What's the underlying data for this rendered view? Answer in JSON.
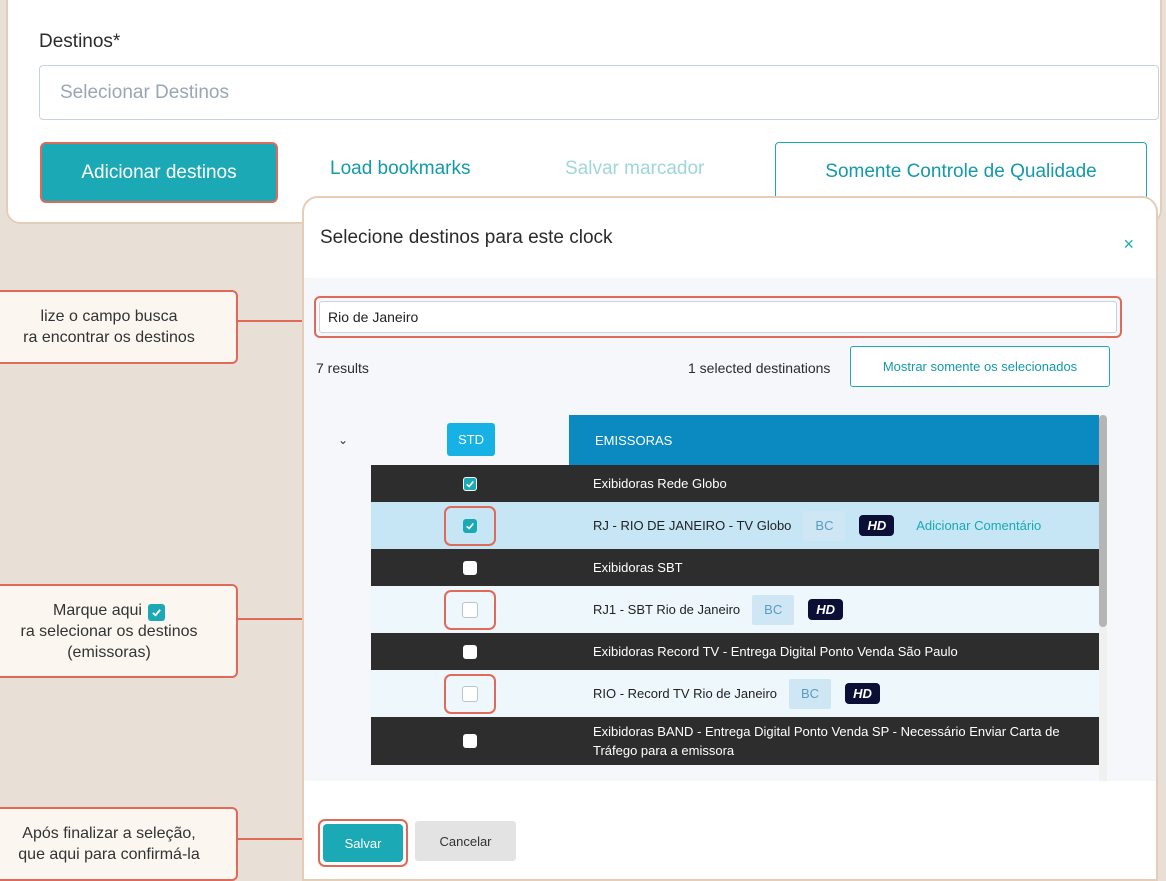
{
  "form": {
    "destinations_label": "Destinos*",
    "destinations_placeholder": "Selecionar Destinos",
    "add_button": "Adicionar destinos",
    "load_bookmarks": "Load bookmarks",
    "save_bookmark": "Salvar marcador",
    "quality_only": "Somente Controle de Qualidade"
  },
  "modal": {
    "title": "Selecione destinos para este clock",
    "close": "×",
    "search_value": "Rio de Janeiro",
    "results": "7 results",
    "selected_count": "1 selected destinations",
    "show_selected_button": "Mostrar somente os selecionados",
    "std_label": "STD",
    "column_header": "EMISSORAS",
    "groups": [
      {
        "label": "Exibidoras Rede Globo",
        "checked": true
      },
      {
        "label": "Exibidoras SBT",
        "checked": false
      },
      {
        "label": "Exibidoras Record TV - Entrega Digital Ponto Venda São Paulo",
        "checked": false
      },
      {
        "label": "Exibidoras BAND - Entrega Digital Ponto Venda SP - Necessário Enviar Carta de Tráfego para a emissora",
        "checked": false
      }
    ],
    "items": [
      {
        "label": "RJ - RIO DE JANEIRO - TV Globo",
        "bc": "BC",
        "hd": "HD",
        "comment": "Adicionar Comentário",
        "checked": true
      },
      {
        "label": "RJ1 - SBT Rio de Janeiro",
        "bc": "BC",
        "hd": "HD",
        "checked": false
      },
      {
        "label": "RIO - Record TV Rio de Janeiro",
        "bc": "BC",
        "hd": "HD",
        "checked": false
      }
    ],
    "save_button": "Salvar",
    "cancel_button": "Cancelar"
  },
  "callouts": {
    "search_line1": "lize o campo busca",
    "search_line2": "ra encontrar os destinos",
    "check_line1": "Marque aqui",
    "check_line2": "ra selecionar os destinos",
    "check_line3": "(emissoras)",
    "save_line1": "Após finalizar a seleção,",
    "save_line2": "que aqui para confirmá-la"
  },
  "colors": {
    "accent": "#1aa9b5",
    "highlight": "#e06a5a",
    "header_blue": "#0a8ac0",
    "group_row": "#2d2d2d"
  }
}
